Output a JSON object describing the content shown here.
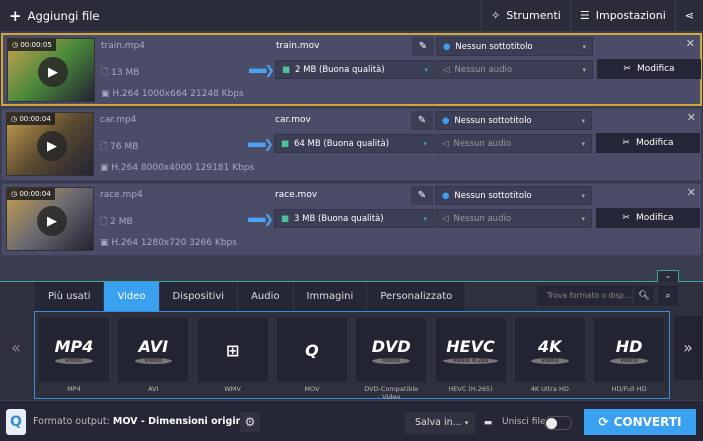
{
  "toolbar": {
    "add_files": "Aggiungi file",
    "tools": "Strumenti",
    "settings": "Impostazioni"
  },
  "files": [
    {
      "duration": "00:00:05",
      "source_name": "train.mp4",
      "source_size": "13 MB",
      "source_info": "H.264 1000x664 21248 Kbps",
      "output_name": "train.mov",
      "output_size": "2 MB (Buona qualità)",
      "subtitle": "Nessun sottotitolo",
      "audio": "Nessun audio",
      "edit": "Modifica",
      "thumb": "#4a8a3a"
    },
    {
      "duration": "00:00:04",
      "source_name": "car.mp4",
      "source_size": "76 MB",
      "source_info": "H.264 8000x4000 129181 Kbps",
      "output_name": "car.mov",
      "output_size": "64 MB (Buona qualità)",
      "subtitle": "Nessun sottotitolo",
      "audio": "Nessun audio",
      "edit": "Modifica",
      "thumb": "#5a4a30"
    },
    {
      "duration": "00:00:04",
      "source_name": "race.mp4",
      "source_size": "2 MB",
      "source_info": "H.264 1280x720 3266 Kbps",
      "output_name": "race.mov",
      "output_size": "3 MB (Buona qualità)",
      "subtitle": "Nessun sottotitolo",
      "audio": "Nessun audio",
      "edit": "Modifica",
      "thumb": "#6a6a70"
    }
  ],
  "tabs": [
    "Più usati",
    "Video",
    "Dispositivi",
    "Audio",
    "Immagini",
    "Personalizzato"
  ],
  "active_tab": "Video",
  "search_placeholder": "Trova formato o disp...",
  "formats": [
    {
      "logo": "MP4",
      "sub": "VIDEO",
      "label": "MP4"
    },
    {
      "logo": "AVI",
      "sub": "VIDEO",
      "label": "AVI"
    },
    {
      "logo": "⊞",
      "sub": "",
      "label": "WMV"
    },
    {
      "logo": "Q",
      "sub": "",
      "label": "MOV"
    },
    {
      "logo": "DVD",
      "sub": "VIDEO",
      "label": "DVD-Compatible Video"
    },
    {
      "logo": "HEVC",
      "sub": "VIDEO H.265",
      "label": "HEVC (H.265)"
    },
    {
      "logo": "4K",
      "sub": "VIDEO",
      "label": "4K Ultra HD"
    },
    {
      "logo": "HD",
      "sub": "VIDEO",
      "label": "HD/Full HD"
    }
  ],
  "bottom": {
    "format_prefix": "Formato output:",
    "format_value": "MOV - Dimensioni originali",
    "save_in": "Salva in...",
    "merge": "Unisci file:",
    "convert": "CONVERTI"
  },
  "colors": {
    "accent": "#3aa0f0",
    "selected_border": "#d2a63a"
  }
}
